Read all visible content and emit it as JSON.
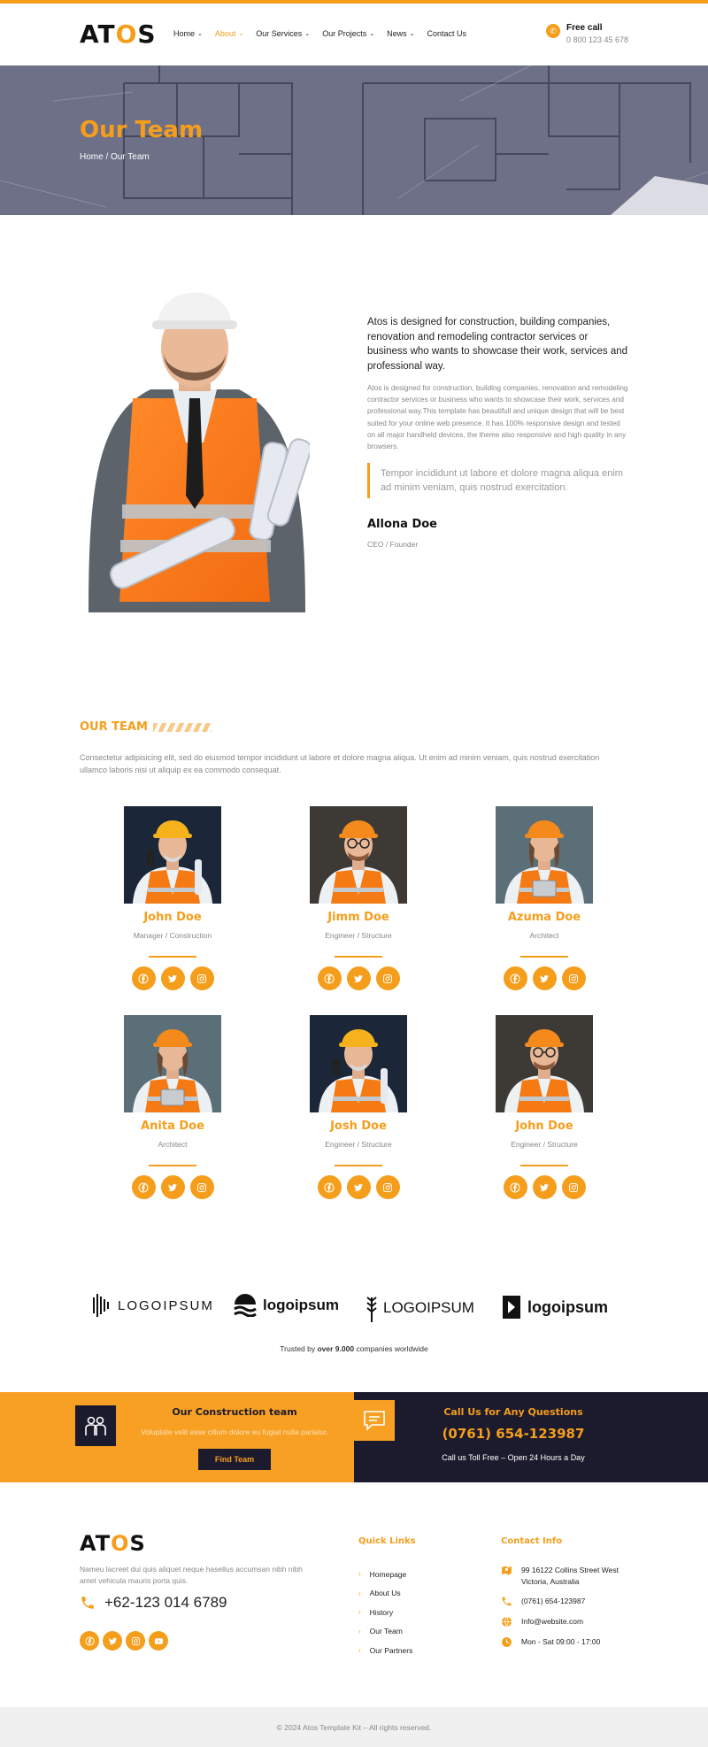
{
  "brand": {
    "logo_pre": "AT",
    "logo_o": "O",
    "logo_post": "S",
    "accent": "#f59e1c",
    "dark": "#1c1b2e"
  },
  "nav": [
    {
      "label": "Home",
      "dropdown": true,
      "active": false
    },
    {
      "label": "About",
      "dropdown": true,
      "active": true
    },
    {
      "label": "Our Services",
      "dropdown": true,
      "active": false
    },
    {
      "label": "Our Projects",
      "dropdown": true,
      "active": false
    },
    {
      "label": "News",
      "dropdown": true,
      "active": false
    },
    {
      "label": "Contact Us",
      "dropdown": false,
      "active": false
    }
  ],
  "header": {
    "call_label": "Free call",
    "call_number": "0 800 123 45 678"
  },
  "hero": {
    "title": "Our Team",
    "breadcrumb": "Home / Our Team"
  },
  "about": {
    "lead": "Atos is designed for construction, building companies, renovation and remodeling contractor services or business who wants to showcase their work, services and professional way.",
    "body": "Atos is designed for construction, building companies, renovation and remodeling contractor services or business who wants to showcase their work, services and professional way.This template has beautifull and unique design that will be best suited for your online web presence. It has 100% responsive design and tested on all major handheld devices, the theme also responsive and high quality in any browsers.",
    "quote": "Tempor incididunt ut labore et dolore magna aliqua enim ad minim veniam, quis nostrud exercitation.",
    "name": "Allona Doe",
    "role": "CEO / Founder"
  },
  "team": {
    "heading": "OUR TEAM",
    "description": "Consectetur adipisicing elit, sed do eiusmod tempor incididunt ut labore et dolore magna aliqua. Ut enim ad minim veniam, quis nostrud exercitation ullamco laboris nisi ut aliquip ex ea commodo consequat.",
    "members": [
      {
        "name": "John Doe",
        "role": "Manager / Construction",
        "photo": "older-man-yellow-helmet-icon"
      },
      {
        "name": "Jimm Doe",
        "role": "Engineer / Structure",
        "photo": "man-glasses-helmet-icon"
      },
      {
        "name": "Azuma Doe",
        "role": "Architect",
        "photo": "woman-helmet-tablet-icon"
      },
      {
        "name": "Anita Doe",
        "role": "Architect",
        "photo": "woman-helmet-tablet-icon"
      },
      {
        "name": "Josh Doe",
        "role": "Engineer / Structure",
        "photo": "older-man-yellow-helmet-icon"
      },
      {
        "name": "John Doe",
        "role": "Engineer / Structure",
        "photo": "man-glasses-helmet-icon"
      }
    ],
    "socials": [
      "facebook-icon",
      "twitter-icon",
      "instagram-icon"
    ]
  },
  "partners": {
    "logos": [
      "LOGOIPSUM",
      "logoipsum",
      "LOGOIPSUM",
      "logoipsum"
    ],
    "trusted_pre": "Trusted by ",
    "trusted_bold": "over 9.000",
    "trusted_post": " companies worldwide"
  },
  "cta": {
    "title": "Our Construction team",
    "subtitle": "Voluptate velit esse cillum dolore eu fugiat nulla pariatur.",
    "button": "Find Team",
    "call_title": "Call Us for Any Questions",
    "call_number": "(0761) 654-123987",
    "call_sub": "Call us Toll Free – Open 24 Hours a Day"
  },
  "footer": {
    "description": "Nameu lacreet dui quis aliquet neque hasellus accumsan nibh nibh amet vehicula mauris porta quis.",
    "phone": "+62-123 014 6789",
    "socials": [
      "facebook-icon",
      "twitter-icon",
      "instagram-icon",
      "youtube-icon"
    ],
    "quick_links_title": "Quick Links",
    "quick_links": [
      "Homepage",
      "About Us",
      "History",
      "Our Team",
      "Our Partners"
    ],
    "contact_title": "Contact Info",
    "contact": [
      {
        "icon": "map-icon",
        "text": "99 16122 Collins Street West Victoria, Australia"
      },
      {
        "icon": "phone-icon",
        "text": "(0761) 654-123987"
      },
      {
        "icon": "globe-icon",
        "text": "Info@website.com"
      },
      {
        "icon": "clock-icon",
        "text": "Mon - Sat 09:00 - 17:00"
      }
    ],
    "copyright": "© 2024 Atos Template Kit – All rights reserved."
  }
}
